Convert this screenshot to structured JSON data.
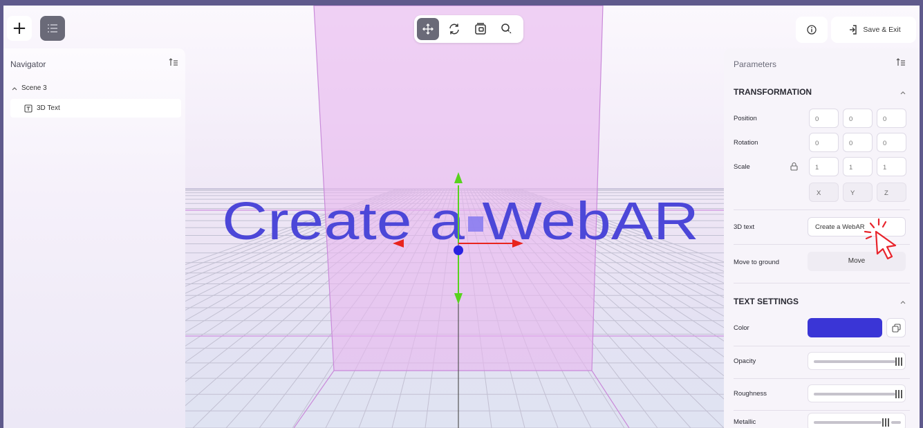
{
  "toolbar": {
    "add_icon": "plus-icon",
    "nav_toggle_icon": "list-icon",
    "tools": [
      "move-tool-icon",
      "rotate-tool-icon",
      "scale-tool-icon",
      "zoom-tool-icon"
    ],
    "active_tool": "move-tool-icon"
  },
  "header": {
    "info_icon": "info-icon",
    "save_exit_label": "Save & Exit"
  },
  "navigator": {
    "title": "Navigator",
    "scene_label": "Scene 3",
    "item_label": "3D Text"
  },
  "viewport": {
    "text_3d": "Create a WebAR"
  },
  "parameters": {
    "title": "Parameters",
    "transformation": {
      "title": "TRANSFORMATION",
      "position_label": "Position",
      "position": [
        "0",
        "0",
        "0"
      ],
      "rotation_label": "Rotation",
      "rotation": [
        "0",
        "0",
        "0"
      ],
      "scale_label": "Scale",
      "scale": [
        "1",
        "1",
        "1"
      ],
      "axes": [
        "X",
        "Y",
        "Z"
      ],
      "text_label": "3D text",
      "text_value": "Create a WebAR",
      "move_ground_label": "Move to ground",
      "move_button": "Move"
    },
    "text_settings": {
      "title": "TEXT SETTINGS",
      "color_label": "Color",
      "color_value": "#3a35d6",
      "opacity_label": "Opacity",
      "opacity": 1.0,
      "roughness_label": "Roughness",
      "roughness": 1.0,
      "metallic_label": "Metallic",
      "metallic": 0.85
    }
  }
}
